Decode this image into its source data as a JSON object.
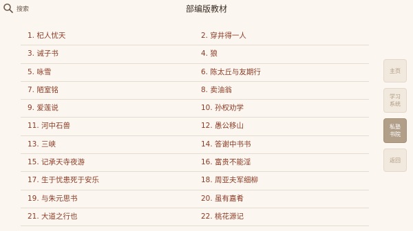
{
  "header": {
    "search_label": "搜索",
    "title": "部编版教材"
  },
  "lessons": [
    {
      "left": "1. 杞人忧天",
      "right": "2. 穿井得一人"
    },
    {
      "left": "3. 诫子书",
      "right": "4. 狼"
    },
    {
      "left": "5. 咏雪",
      "right": "6. 陈太丘与友期行"
    },
    {
      "left": "7. 陋室铭",
      "right": "8. 卖油翁"
    },
    {
      "left": "9. 爱莲说",
      "right": "10. 孙权劝学"
    },
    {
      "left": "11. 河中石兽",
      "right": "12. 愚公移山"
    },
    {
      "left": "13. 三峡",
      "right": "14. 答谢中书书"
    },
    {
      "left": "15. 记承天寺夜游",
      "right": "16. 富贵不能淫"
    },
    {
      "left": "17. 生于忧患死于安乐",
      "right": "18. 周亚夫军细柳"
    },
    {
      "left": "19. 与朱元思书",
      "right": "20. 虽有嘉肴"
    },
    {
      "left": "21. 大道之行也",
      "right": "22. 桃花源记"
    }
  ],
  "sidebar": {
    "home": "主页",
    "study": "学习系统",
    "academy": "私塾书院",
    "back": "返回"
  },
  "colors": {
    "background": "#fbf6ef",
    "item_text": "#8b3b25",
    "active_tab": "#b29f8a"
  }
}
